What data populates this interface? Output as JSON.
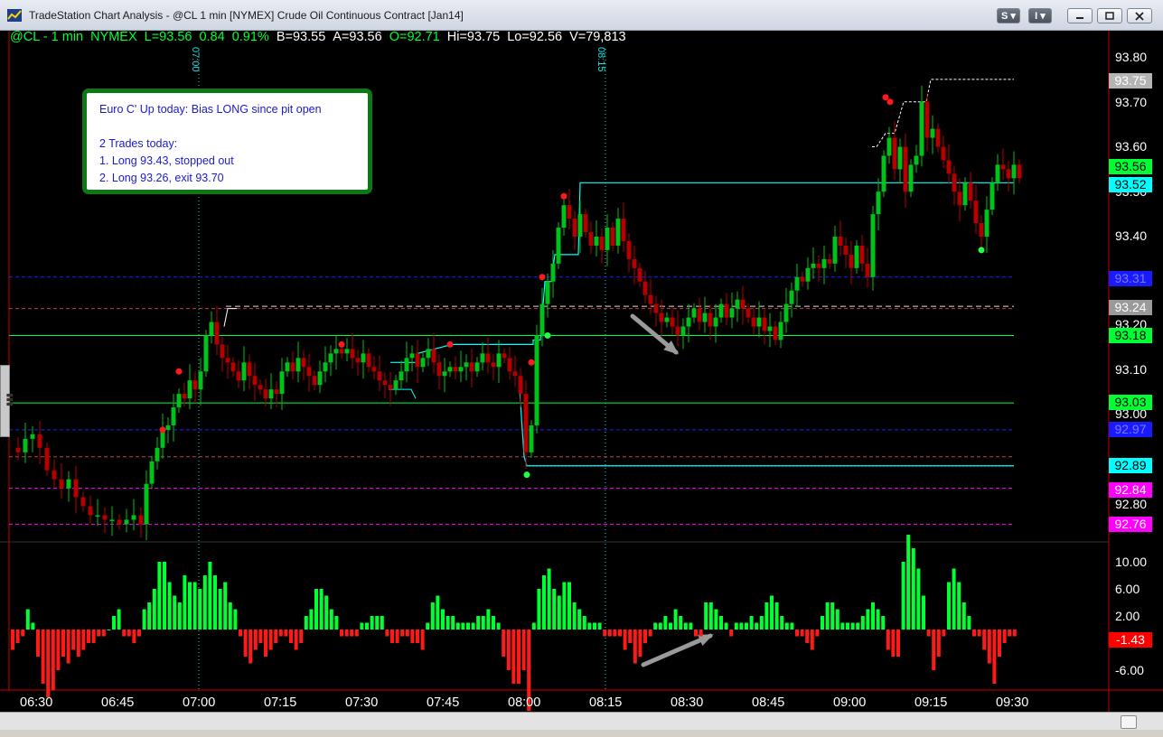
{
  "window": {
    "title": "TradeStation Chart Analysis - @CL 1 min [NYMEX] Crude Oil Continuous Contract [Jan14]",
    "buttons": [
      "S",
      "I"
    ]
  },
  "legend": {
    "symbol": "@CL - 1 min",
    "exchange": "NYMEX",
    "last": "L=93.56",
    "change": "0.84",
    "change_pct": "0.91%",
    "bid": "B=93.55",
    "ask": "A=93.56",
    "open": "O=92.71",
    "high": "Hi=93.75",
    "low": "Lo=92.56",
    "volume": "V=79,813"
  },
  "note": {
    "lines": [
      "Euro C' Up today: Bias LONG since pit open",
      "",
      "2 Trades today:",
      "1. Long 93.43, stopped out",
      "2. Long 93.26, exit 93.70"
    ]
  },
  "price_axis": {
    "labels": [
      "93.80",
      "93.70",
      "93.60",
      "93.50",
      "93.40",
      "93.20",
      "93.10",
      "93.00",
      "92.80"
    ],
    "tags": [
      {
        "text": "93.75",
        "bg": "#b4b4b4",
        "fg": "#ffffff"
      },
      {
        "text": "93.56",
        "bg": "#00ff33",
        "fg": "#000000"
      },
      {
        "text": "93.52",
        "bg": "#00ffff",
        "fg": "#000000"
      },
      {
        "text": "93.31",
        "bg": "#1a1aff",
        "fg": "#7a7aff"
      },
      {
        "text": "93.24",
        "bg": "#9a9a9a",
        "fg": "#ffffff"
      },
      {
        "text": "93.18",
        "bg": "#00ff33",
        "fg": "#000000"
      },
      {
        "text": "93.03",
        "bg": "#00ff33",
        "fg": "#000000"
      },
      {
        "text": "92.97",
        "bg": "#1a1aff",
        "fg": "#7a7aff"
      },
      {
        "text": "92.89",
        "bg": "#00ffff",
        "fg": "#000000"
      },
      {
        "text": "92.84",
        "bg": "#ff00ff",
        "fg": "#ffffff"
      },
      {
        "text": "92.76",
        "bg": "#ff00ff",
        "fg": "#ffffff"
      }
    ]
  },
  "osc_axis": {
    "labels": [
      "10.00",
      "6.00",
      "2.00",
      "-6.00"
    ],
    "tag": {
      "text": "-1.43",
      "bg": "#ff0000",
      "fg": "#ffffff"
    }
  },
  "time_axis": [
    "06:30",
    "06:45",
    "07:00",
    "07:15",
    "07:30",
    "07:45",
    "08:00",
    "08:15",
    "08:30",
    "08:45",
    "09:00",
    "09:15",
    "09:30"
  ],
  "session_markers": [
    "07:00",
    "08:15"
  ],
  "colors": {
    "up_candle": "#00c21a",
    "down_candle": "#b40000",
    "pivot_blue": "#2020ff",
    "green_level": "#00ff33",
    "cyan_line": "#00ffff",
    "magenta_level": "#ff00ff",
    "osc_positive": "#00ff33",
    "osc_negative": "#ff1a1a"
  }
}
